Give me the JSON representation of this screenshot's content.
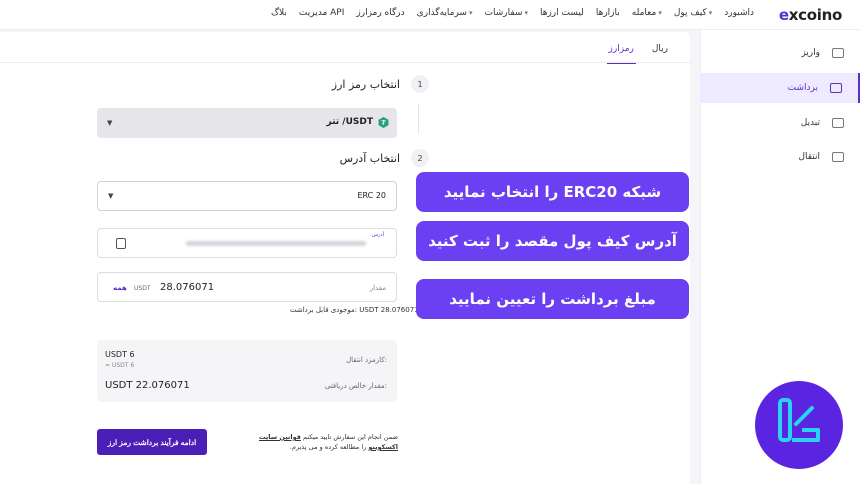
{
  "logo": {
    "prefix": "e",
    "rest": "xcoino"
  },
  "nav": [
    {
      "label": "داشبورد",
      "dropdown": false
    },
    {
      "label": "کیف پول",
      "dropdown": true
    },
    {
      "label": "معامله",
      "dropdown": true
    },
    {
      "label": "بازارها",
      "dropdown": false
    },
    {
      "label": "لیست ارزها",
      "dropdown": false
    },
    {
      "label": "سفارشات",
      "dropdown": true
    },
    {
      "label": "سرمایه‌گذاری",
      "dropdown": true
    },
    {
      "label": "درگاه رمزارز",
      "dropdown": false
    },
    {
      "label": "مدیریت API",
      "dropdown": false
    },
    {
      "label": "بلاگ",
      "dropdown": false
    }
  ],
  "sidebar": {
    "items": [
      {
        "label": "واریز",
        "icon": "deposit-icon"
      },
      {
        "label": "برداشت",
        "icon": "withdraw-icon",
        "active": true
      },
      {
        "label": "تبدیل",
        "icon": "convert-icon"
      },
      {
        "label": "انتقال",
        "icon": "transfer-icon"
      }
    ]
  },
  "tabs": {
    "rial": "ریال",
    "crypto": "رمزارز"
  },
  "step1": {
    "num": "1",
    "title": "انتخاب رمز ارز",
    "coin": "تتر /USDT"
  },
  "step2": {
    "num": "2",
    "title": "انتخاب آدرس",
    "network": "ERC 20"
  },
  "address": {
    "label": "آدرس"
  },
  "amount": {
    "label": "مقدار",
    "value": "28.076071",
    "unit": "USDT",
    "all": "همه"
  },
  "balance": "موجودی قابل برداشت: USDT 28.076071",
  "fees": {
    "fee_label": "کارمزد انتقال:",
    "fee_value": "USDT 6",
    "fee_sub": "≈ USDT 6",
    "net_label": "مقدار خالص دریافتی:",
    "net_value": "USDT 22.076071"
  },
  "terms": {
    "before": "ضمن انجام این سفارش تایید میکنم ",
    "link": "قوانین سایت اکسکوینو",
    "after": " را مطالعه کرده و می پذیرم."
  },
  "submit_label": "ادامه فرآیند برداشت رمز ارز",
  "callouts": [
    "شبکه ERC20 را انتخاب نمایید",
    "آدرس کیف پول مقصد را ثبت کنید",
    "مبلغ برداشت را تعیین نمایید"
  ],
  "colors": {
    "accent": "#5b2fc9",
    "callout": "#6b3ff2",
    "tether": "#26a17b"
  }
}
